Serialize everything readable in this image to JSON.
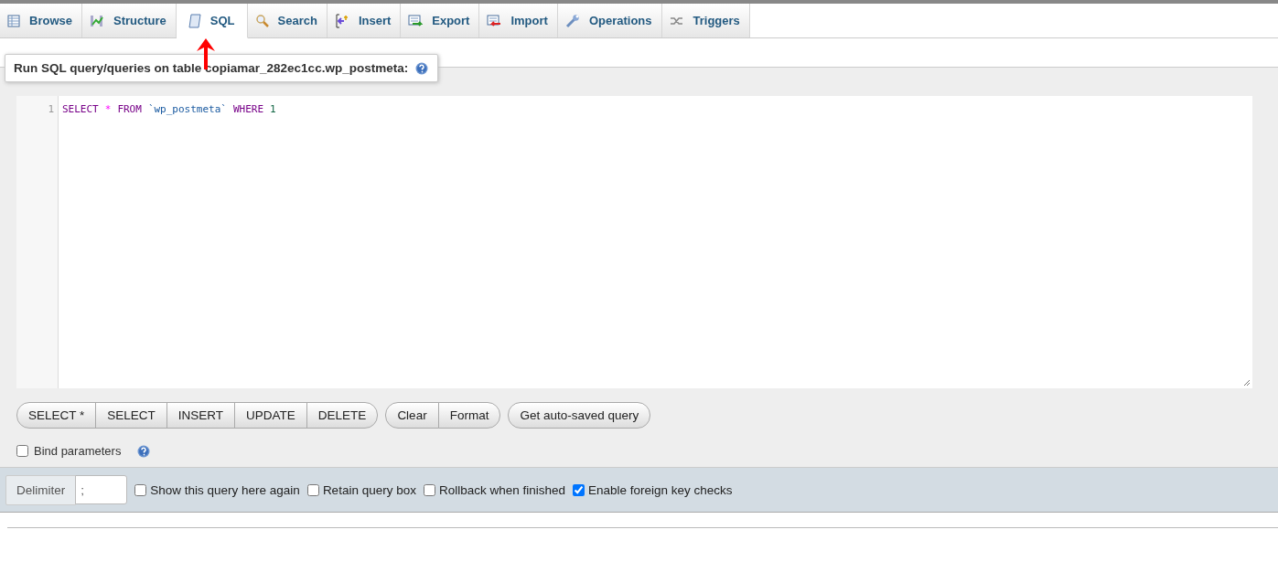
{
  "tabs": [
    {
      "label": "Browse",
      "selected": false
    },
    {
      "label": "Structure",
      "selected": false
    },
    {
      "label": "SQL",
      "selected": true
    },
    {
      "label": "Search",
      "selected": false
    },
    {
      "label": "Insert",
      "selected": false
    },
    {
      "label": "Export",
      "selected": false
    },
    {
      "label": "Import",
      "selected": false
    },
    {
      "label": "Operations",
      "selected": false
    },
    {
      "label": "Triggers",
      "selected": false
    }
  ],
  "legend": "Run SQL query/queries on table copiamar_282ec1cc.wp_postmeta:",
  "editor": {
    "line_number": "1",
    "tokens": [
      {
        "text": "SELECT",
        "kind": "keyword"
      },
      {
        "text": "*",
        "kind": "operator"
      },
      {
        "text": "FROM",
        "kind": "keyword"
      },
      {
        "text": "`wp_postmeta`",
        "kind": "string"
      },
      {
        "text": "WHERE",
        "kind": "keyword"
      },
      {
        "text": "1",
        "kind": "number"
      }
    ]
  },
  "button_groups": [
    [
      "SELECT *",
      "SELECT",
      "INSERT",
      "UPDATE",
      "DELETE"
    ],
    [
      "Clear",
      "Format"
    ],
    [
      "Get auto-saved query"
    ]
  ],
  "bind_parameters": {
    "label": "Bind parameters",
    "checked": false
  },
  "footer": {
    "delimiter_label": "Delimiter",
    "delimiter_value": ";",
    "options": [
      {
        "label": "Show this query here again",
        "checked": false
      },
      {
        "label": "Retain query box",
        "checked": false
      },
      {
        "label": "Rollback when finished",
        "checked": false
      },
      {
        "label": "Enable foreign key checks",
        "checked": true
      }
    ]
  }
}
